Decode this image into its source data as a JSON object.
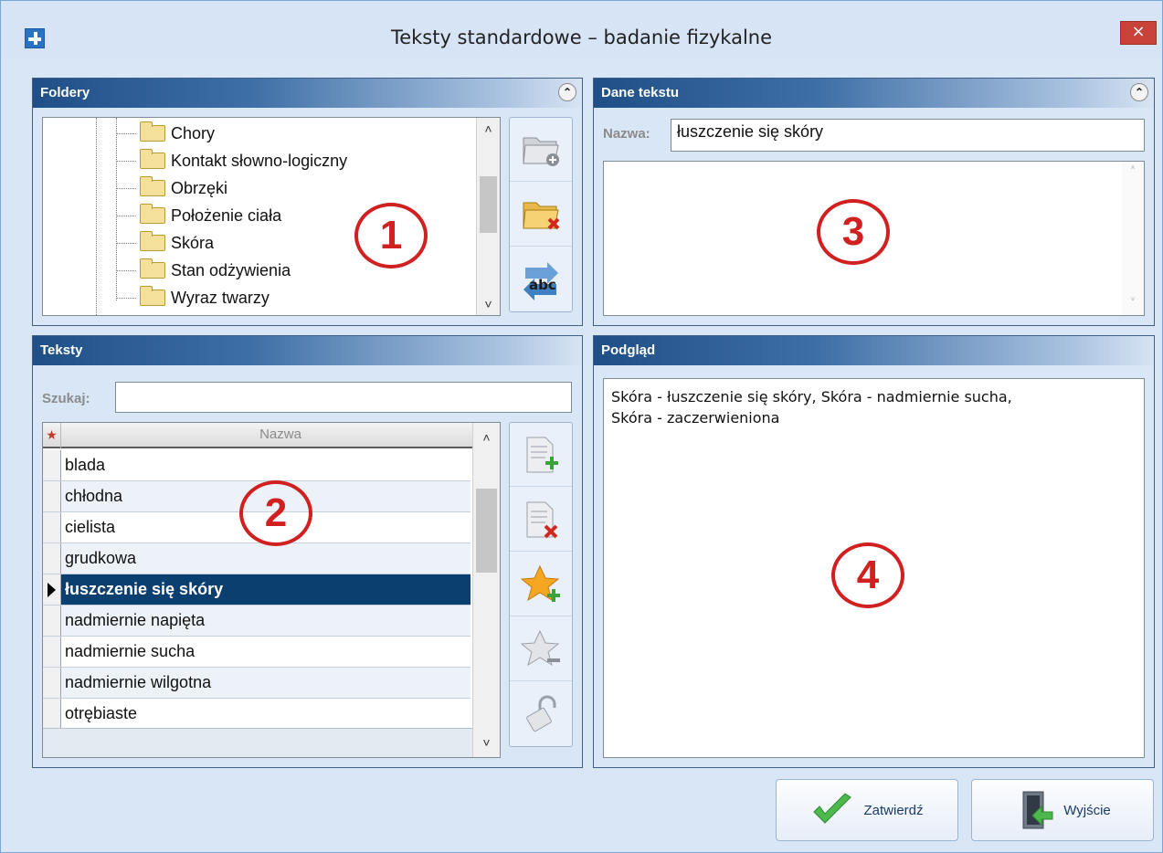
{
  "window": {
    "title": "Teksty standardowe – badanie fizykalne",
    "close_symbol": "×"
  },
  "panels": {
    "folders": {
      "header": "Foldery",
      "collapse_symbol": "⌃",
      "items": [
        "Chory",
        "Kontakt słowno-logiczny",
        "Obrzęki",
        "Położenie ciała",
        "Skóra",
        "Stan odżywienia",
        "Wyraz twarzy"
      ],
      "tools": [
        "add-folder-icon",
        "delete-folder-icon",
        "rename-abc-icon"
      ],
      "marker": "1"
    },
    "text_data": {
      "header": "Dane tekstu",
      "collapse_symbol": "⌃",
      "name_label": "Nazwa:",
      "name_value": "łuszczenie się skóry",
      "marker": "3"
    },
    "texts": {
      "header": "Teksty",
      "search_label": "Szukaj:",
      "search_value": "",
      "grid_star": "★",
      "grid_column": "Nazwa",
      "rows": [
        "blada",
        "chłodna",
        "cielista",
        "grudkowa",
        "łuszczenie się skóry",
        "nadmiernie napięta",
        "nadmiernie sucha",
        "nadmiernie wilgotna",
        "otrębiaste"
      ],
      "selected_index": 4,
      "tools": [
        "add-text-icon",
        "delete-text-icon",
        "add-favorite-icon",
        "remove-favorite-icon",
        "unlock-icon"
      ],
      "marker": "2"
    },
    "preview": {
      "header": "Podgląd",
      "text_line1": "Skóra - łuszczenie się skóry, Skóra - nadmiernie sucha,",
      "text_line2": "Skóra - zaczerwieniona",
      "marker": "4"
    }
  },
  "buttons": {
    "confirm": "Zatwierdź",
    "exit": "Wyjście"
  },
  "colors": {
    "header_dark": "#1f4f86",
    "selection": "#0b3f70",
    "marker_red": "#d02020",
    "window_bg": "#d9e6f6"
  }
}
